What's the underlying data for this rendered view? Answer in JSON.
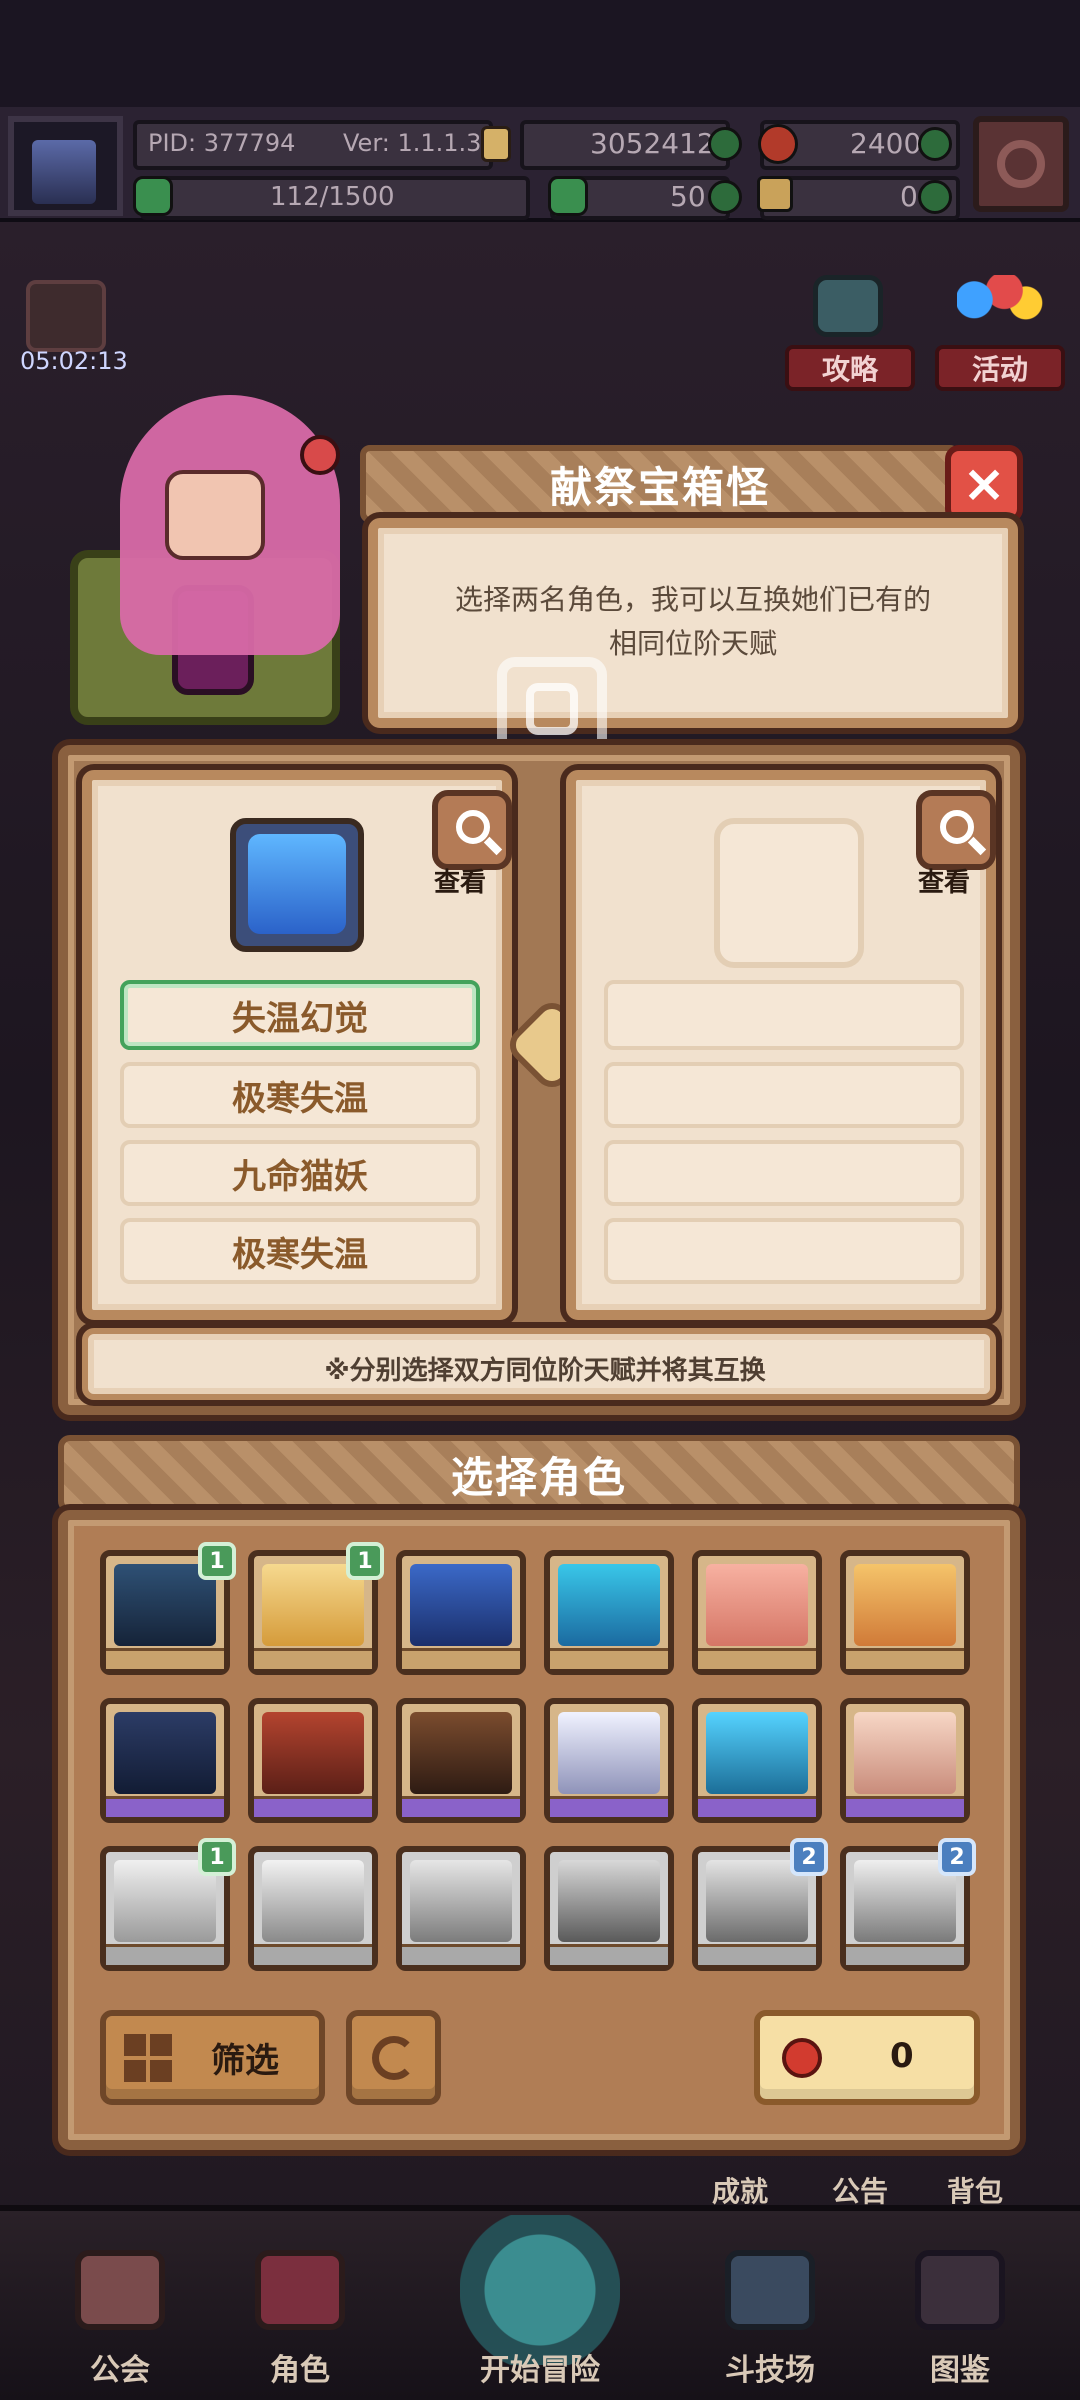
{
  "topbar": {
    "pid_label": "PID: 377794",
    "ver_label": "Ver: 1.1.1.3",
    "gold": "3052412",
    "red_gems": "2400",
    "clover_progress": "112/1500",
    "clover_count": "50",
    "bag_count": "0"
  },
  "timer": "05:02:13",
  "side_buttons": {
    "guide": "攻略",
    "activity": "活动"
  },
  "dialog": {
    "title": "献祭宝箱怪",
    "description": "选择两名角色，我可以互换她们已有的相同位阶天赋",
    "left_panel": {
      "view_label": "查看",
      "talents": [
        "失温幻觉",
        "极寒失温",
        "九命猫妖",
        "极寒失温"
      ],
      "selected_index": 0
    },
    "right_panel": {
      "view_label": "查看"
    },
    "hint": "※分别选择双方同位阶天赋并将其互换"
  },
  "select_panel": {
    "title": "选择角色",
    "filter_label": "筛选",
    "cost_value": "0",
    "badges": {
      "r1c1": "1",
      "r1c2": "1",
      "r3c1": "1",
      "r3c5": "2",
      "r3c6": "2"
    }
  },
  "bottom_nav": {
    "guild": "公会",
    "character": "角色",
    "adventure": "开始冒险",
    "arena": "斗技场",
    "codex": "图鉴",
    "achievement": "成就",
    "notice": "公告",
    "bag": "背包"
  },
  "colors": {
    "panel": "#f1e1ce",
    "panel_border": "#b8895e",
    "accent_green": "#43a25b",
    "text_brown": "#8a5a2b"
  }
}
